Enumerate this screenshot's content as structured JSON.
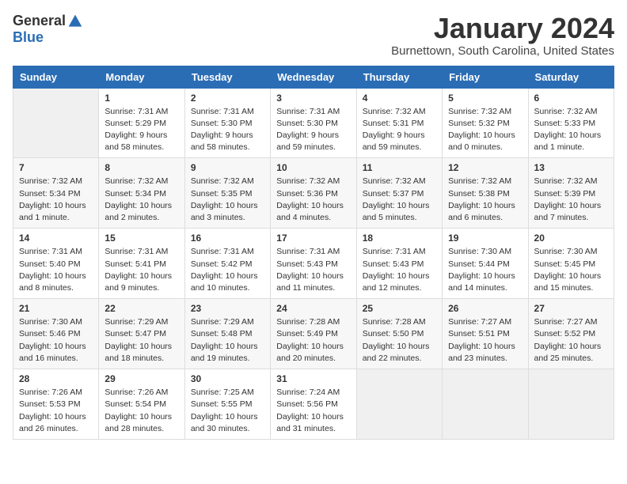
{
  "app": {
    "logo_general": "General",
    "logo_blue": "Blue"
  },
  "header": {
    "title": "January 2024",
    "location": "Burnettown, South Carolina, United States"
  },
  "calendar": {
    "days_of_week": [
      "Sunday",
      "Monday",
      "Tuesday",
      "Wednesday",
      "Thursday",
      "Friday",
      "Saturday"
    ],
    "weeks": [
      [
        {
          "day": "",
          "info": ""
        },
        {
          "day": "1",
          "info": "Sunrise: 7:31 AM\nSunset: 5:29 PM\nDaylight: 9 hours\nand 58 minutes."
        },
        {
          "day": "2",
          "info": "Sunrise: 7:31 AM\nSunset: 5:30 PM\nDaylight: 9 hours\nand 58 minutes."
        },
        {
          "day": "3",
          "info": "Sunrise: 7:31 AM\nSunset: 5:30 PM\nDaylight: 9 hours\nand 59 minutes."
        },
        {
          "day": "4",
          "info": "Sunrise: 7:32 AM\nSunset: 5:31 PM\nDaylight: 9 hours\nand 59 minutes."
        },
        {
          "day": "5",
          "info": "Sunrise: 7:32 AM\nSunset: 5:32 PM\nDaylight: 10 hours\nand 0 minutes."
        },
        {
          "day": "6",
          "info": "Sunrise: 7:32 AM\nSunset: 5:33 PM\nDaylight: 10 hours\nand 1 minute."
        }
      ],
      [
        {
          "day": "7",
          "info": "Sunrise: 7:32 AM\nSunset: 5:34 PM\nDaylight: 10 hours\nand 1 minute."
        },
        {
          "day": "8",
          "info": "Sunrise: 7:32 AM\nSunset: 5:34 PM\nDaylight: 10 hours\nand 2 minutes."
        },
        {
          "day": "9",
          "info": "Sunrise: 7:32 AM\nSunset: 5:35 PM\nDaylight: 10 hours\nand 3 minutes."
        },
        {
          "day": "10",
          "info": "Sunrise: 7:32 AM\nSunset: 5:36 PM\nDaylight: 10 hours\nand 4 minutes."
        },
        {
          "day": "11",
          "info": "Sunrise: 7:32 AM\nSunset: 5:37 PM\nDaylight: 10 hours\nand 5 minutes."
        },
        {
          "day": "12",
          "info": "Sunrise: 7:32 AM\nSunset: 5:38 PM\nDaylight: 10 hours\nand 6 minutes."
        },
        {
          "day": "13",
          "info": "Sunrise: 7:32 AM\nSunset: 5:39 PM\nDaylight: 10 hours\nand 7 minutes."
        }
      ],
      [
        {
          "day": "14",
          "info": "Sunrise: 7:31 AM\nSunset: 5:40 PM\nDaylight: 10 hours\nand 8 minutes."
        },
        {
          "day": "15",
          "info": "Sunrise: 7:31 AM\nSunset: 5:41 PM\nDaylight: 10 hours\nand 9 minutes."
        },
        {
          "day": "16",
          "info": "Sunrise: 7:31 AM\nSunset: 5:42 PM\nDaylight: 10 hours\nand 10 minutes."
        },
        {
          "day": "17",
          "info": "Sunrise: 7:31 AM\nSunset: 5:43 PM\nDaylight: 10 hours\nand 11 minutes."
        },
        {
          "day": "18",
          "info": "Sunrise: 7:31 AM\nSunset: 5:43 PM\nDaylight: 10 hours\nand 12 minutes."
        },
        {
          "day": "19",
          "info": "Sunrise: 7:30 AM\nSunset: 5:44 PM\nDaylight: 10 hours\nand 14 minutes."
        },
        {
          "day": "20",
          "info": "Sunrise: 7:30 AM\nSunset: 5:45 PM\nDaylight: 10 hours\nand 15 minutes."
        }
      ],
      [
        {
          "day": "21",
          "info": "Sunrise: 7:30 AM\nSunset: 5:46 PM\nDaylight: 10 hours\nand 16 minutes."
        },
        {
          "day": "22",
          "info": "Sunrise: 7:29 AM\nSunset: 5:47 PM\nDaylight: 10 hours\nand 18 minutes."
        },
        {
          "day": "23",
          "info": "Sunrise: 7:29 AM\nSunset: 5:48 PM\nDaylight: 10 hours\nand 19 minutes."
        },
        {
          "day": "24",
          "info": "Sunrise: 7:28 AM\nSunset: 5:49 PM\nDaylight: 10 hours\nand 20 minutes."
        },
        {
          "day": "25",
          "info": "Sunrise: 7:28 AM\nSunset: 5:50 PM\nDaylight: 10 hours\nand 22 minutes."
        },
        {
          "day": "26",
          "info": "Sunrise: 7:27 AM\nSunset: 5:51 PM\nDaylight: 10 hours\nand 23 minutes."
        },
        {
          "day": "27",
          "info": "Sunrise: 7:27 AM\nSunset: 5:52 PM\nDaylight: 10 hours\nand 25 minutes."
        }
      ],
      [
        {
          "day": "28",
          "info": "Sunrise: 7:26 AM\nSunset: 5:53 PM\nDaylight: 10 hours\nand 26 minutes."
        },
        {
          "day": "29",
          "info": "Sunrise: 7:26 AM\nSunset: 5:54 PM\nDaylight: 10 hours\nand 28 minutes."
        },
        {
          "day": "30",
          "info": "Sunrise: 7:25 AM\nSunset: 5:55 PM\nDaylight: 10 hours\nand 30 minutes."
        },
        {
          "day": "31",
          "info": "Sunrise: 7:24 AM\nSunset: 5:56 PM\nDaylight: 10 hours\nand 31 minutes."
        },
        {
          "day": "",
          "info": ""
        },
        {
          "day": "",
          "info": ""
        },
        {
          "day": "",
          "info": ""
        }
      ]
    ]
  }
}
